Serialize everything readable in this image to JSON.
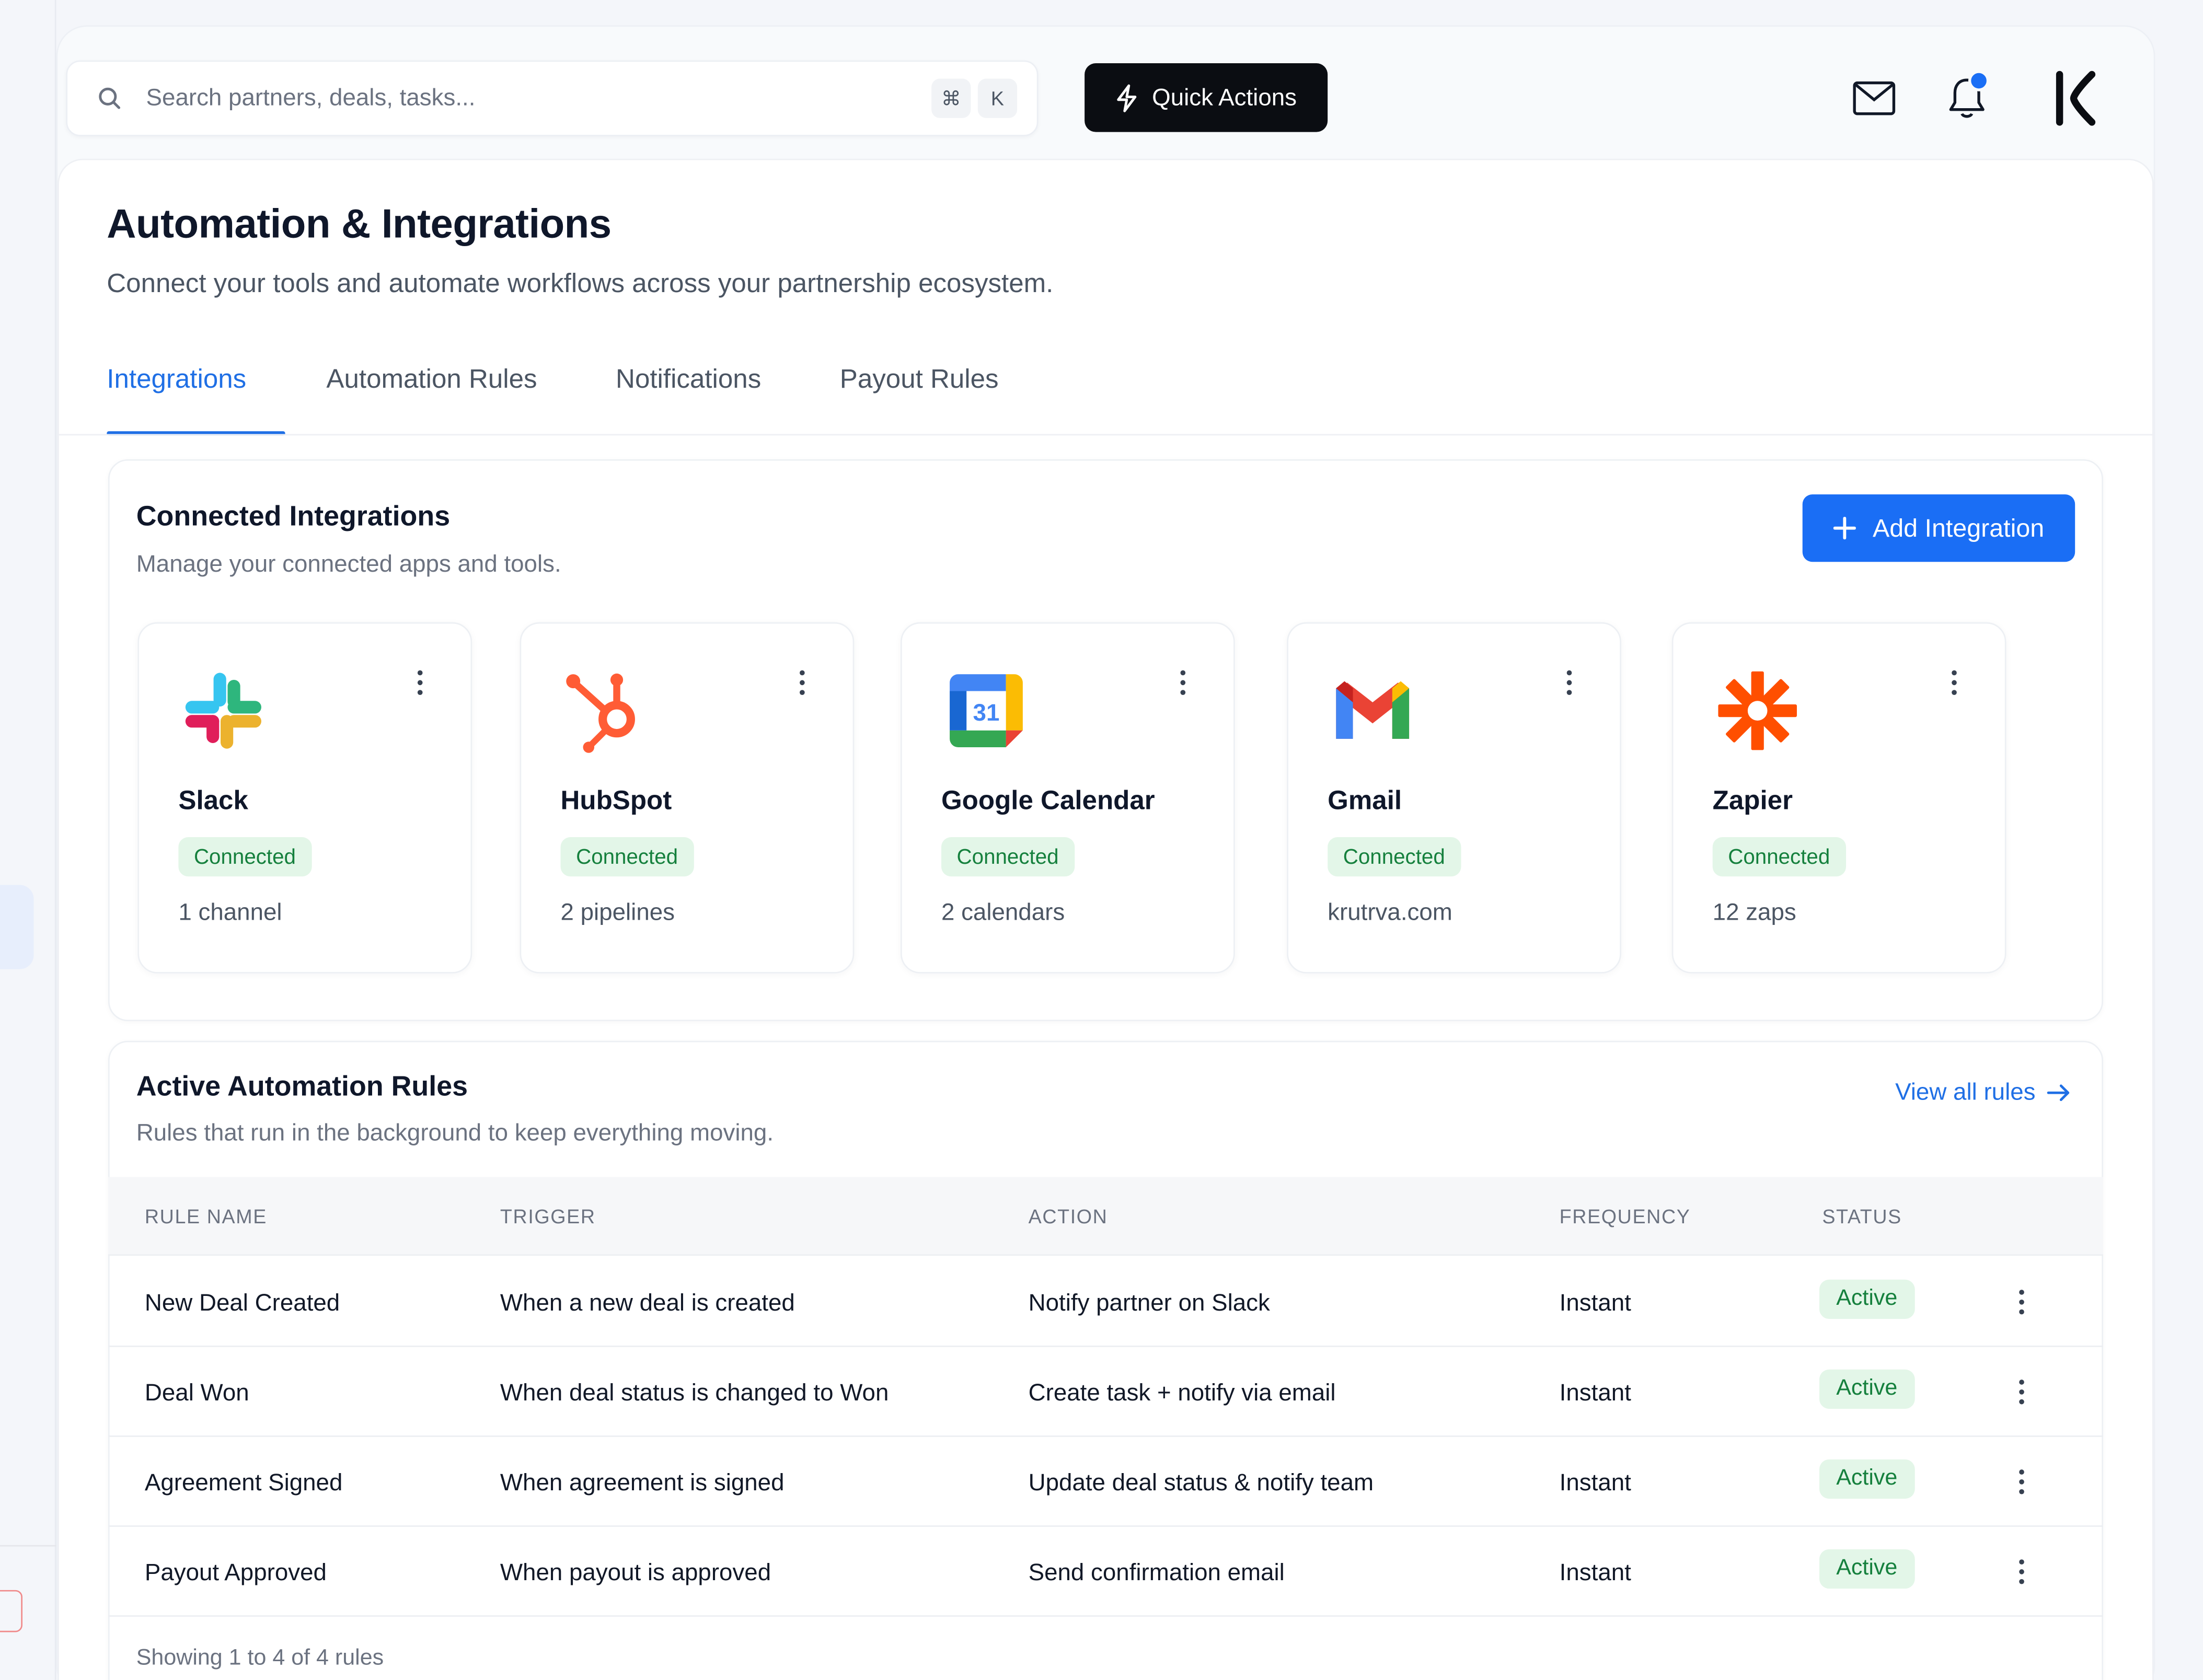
{
  "search": {
    "placeholder": "Search partners, deals, tasks...",
    "shortcut_key1": "⌘",
    "shortcut_key2": "K"
  },
  "topbar": {
    "quick_actions_label": "Quick Actions",
    "brand_logo_text": "K"
  },
  "page": {
    "title": "Automation & Integrations",
    "subtitle": "Connect your tools and automate workflows across your partnership ecosystem."
  },
  "tabs": [
    {
      "label": "Integrations",
      "active": true
    },
    {
      "label": "Automation Rules",
      "active": false
    },
    {
      "label": "Notifications",
      "active": false
    },
    {
      "label": "Payout Rules",
      "active": false
    }
  ],
  "integrations": {
    "title": "Connected Integrations",
    "subtitle": "Manage your connected apps and tools.",
    "add_button_label": "Add Integration",
    "items": [
      {
        "name": "Slack",
        "status": "Connected",
        "detail": "1 channel",
        "icon": "slack-logo-icon"
      },
      {
        "name": "HubSpot",
        "status": "Connected",
        "detail": "2 pipelines",
        "icon": "hubspot-logo-icon"
      },
      {
        "name": "Google Calendar",
        "status": "Connected",
        "detail": "2 calendars",
        "icon": "google-calendar-logo-icon",
        "icon_text": "31"
      },
      {
        "name": "Gmail",
        "status": "Connected",
        "detail": "krutrva.com",
        "icon": "gmail-logo-icon"
      },
      {
        "name": "Zapier",
        "status": "Connected",
        "detail": "12 zaps",
        "icon": "zapier-logo-icon"
      }
    ]
  },
  "rules": {
    "title": "Active Automation Rules",
    "subtitle": "Rules that run in the background to keep everything moving.",
    "view_all_label": "View all rules",
    "columns": [
      "RULE NAME",
      "TRIGGER",
      "ACTION",
      "FREQUENCY",
      "STATUS"
    ],
    "rows": [
      {
        "name": "New Deal Created",
        "trigger": "When a new deal is created",
        "action": "Notify partner on Slack",
        "frequency": "Instant",
        "status": "Active"
      },
      {
        "name": "Deal Won",
        "trigger": "When deal status is changed to Won",
        "action": "Create task + notify via email",
        "frequency": "Instant",
        "status": "Active"
      },
      {
        "name": "Agreement Signed",
        "trigger": "When agreement is signed",
        "action": "Update deal status & notify team",
        "frequency": "Instant",
        "status": "Active"
      },
      {
        "name": "Payout Approved",
        "trigger": "When payout is approved",
        "action": "Send confirmation email",
        "frequency": "Instant",
        "status": "Active"
      }
    ],
    "footer": "Showing 1 to 4 of 4 rules"
  },
  "colors": {
    "accent": "#1a6ef5",
    "success_bg": "#e3f6e8",
    "success_text": "#15803d",
    "dark_button": "#0b0d12"
  }
}
